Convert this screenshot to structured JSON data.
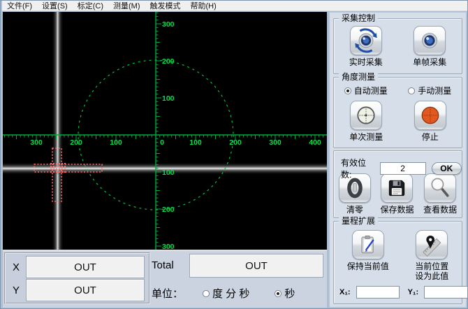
{
  "menu": {
    "items": [
      "文件(F)",
      "设置(S)",
      "标定(C)",
      "测量(M)",
      "触发模式",
      "帮助(H)"
    ]
  },
  "display": {
    "x_axis_labels": [
      {
        "text": "300",
        "u": -300
      },
      {
        "text": "200",
        "u": -200
      },
      {
        "text": "100",
        "u": -100
      },
      {
        "text": "0",
        "u": 0
      },
      {
        "text": "100",
        "u": 100
      },
      {
        "text": "200",
        "u": 200
      },
      {
        "text": "300",
        "u": 300
      },
      {
        "text": "400",
        "u": 400
      }
    ],
    "y_axis_labels": [
      {
        "text": "300",
        "u": 300
      },
      {
        "text": "200",
        "u": 200
      },
      {
        "text": "100",
        "u": 100
      },
      {
        "text": "100",
        "u": -100
      },
      {
        "text": "200",
        "u": -200
      },
      {
        "text": "300",
        "u": -300
      }
    ],
    "circle_radius_units": 200,
    "colors": {
      "grid": "#00a93a",
      "labels": "#00e04f",
      "circle": "#00c040",
      "beam_core": "#ededed",
      "marker": "#ff6b6b"
    }
  },
  "right_panel": {
    "capture_group": {
      "title": "采集控制",
      "buttons": [
        {
          "label": "实时采集"
        },
        {
          "label": "单帧采集"
        }
      ]
    },
    "angle_group": {
      "title": "角度测量",
      "radios": [
        {
          "label": "自动测量",
          "selected": true
        },
        {
          "label": "手动测量",
          "selected": false
        }
      ],
      "buttons": [
        {
          "label": "单次测量"
        },
        {
          "label": "停止"
        }
      ]
    },
    "digits_group": {
      "label": "有效位数:",
      "value": "2",
      "ok_label": "OK",
      "buttons": [
        {
          "label": "清零"
        },
        {
          "label": "保存数据"
        },
        {
          "label": "查看数据"
        }
      ]
    },
    "range_group": {
      "title": "量程扩展",
      "buttons": [
        {
          "label": "保持当前值",
          "label2": ""
        },
        {
          "label": "当前位置",
          "label2": "设为此值"
        }
      ],
      "x1_label": "X₁:",
      "y1_label": "Y₁:",
      "x1_value": "",
      "y1_value": ""
    }
  },
  "bottom_panel": {
    "x_label": "X",
    "x_value": "OUT",
    "y_label": "Y",
    "y_value": "OUT",
    "total_label": "Total",
    "total_value": "OUT",
    "unit_label": "单位：",
    "unit_options": [
      {
        "label": "度 分 秒",
        "selected": false
      },
      {
        "label": "秒",
        "selected": true
      }
    ]
  }
}
